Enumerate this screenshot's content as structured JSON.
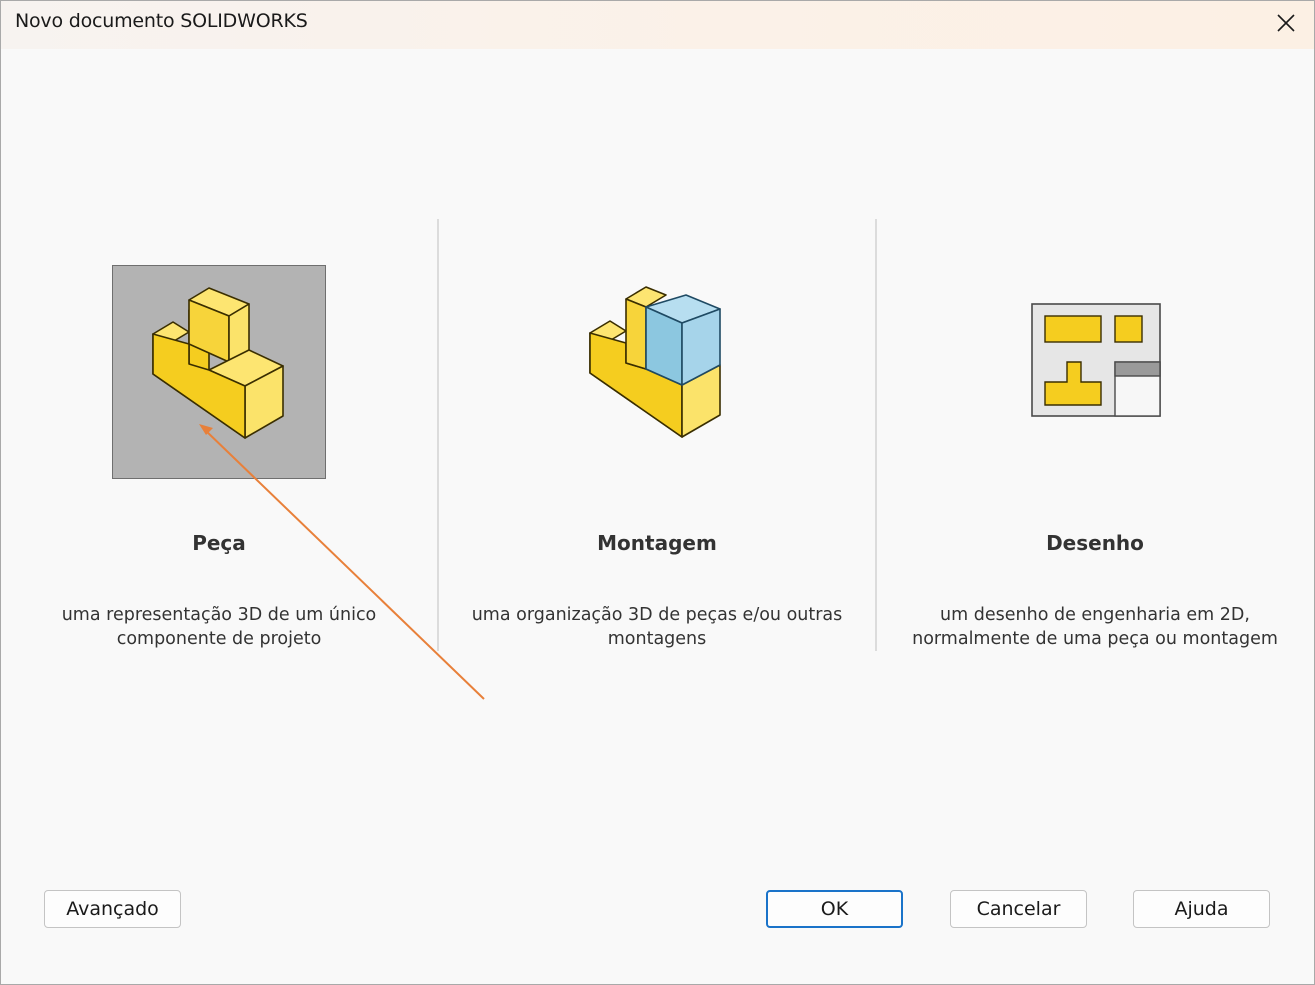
{
  "window": {
    "title": "Novo documento SOLIDWORKS",
    "close_icon": "close-icon"
  },
  "options": [
    {
      "title": "Peça",
      "desc_line1": "uma representação 3D de um único",
      "desc_line2": "componente de projeto",
      "icon": "part-icon",
      "selected": true
    },
    {
      "title": "Montagem",
      "desc_line1": "uma organização 3D de peças e/ou outras",
      "desc_line2": "montagens",
      "icon": "assembly-icon",
      "selected": false
    },
    {
      "title": "Desenho",
      "desc_line1": "um desenho de engenharia em 2D,",
      "desc_line2": "normalmente de uma peça ou montagem",
      "icon": "drawing-icon",
      "selected": false
    }
  ],
  "buttons": {
    "advanced": "Avançado",
    "ok": "OK",
    "cancel": "Cancelar",
    "help": "Ajuda"
  },
  "colors": {
    "part_yellow": "#f5cd1f",
    "assembly_blue": "#8cc7e0",
    "annotation_arrow": "#e8803a",
    "ok_border": "#1a73c9"
  }
}
